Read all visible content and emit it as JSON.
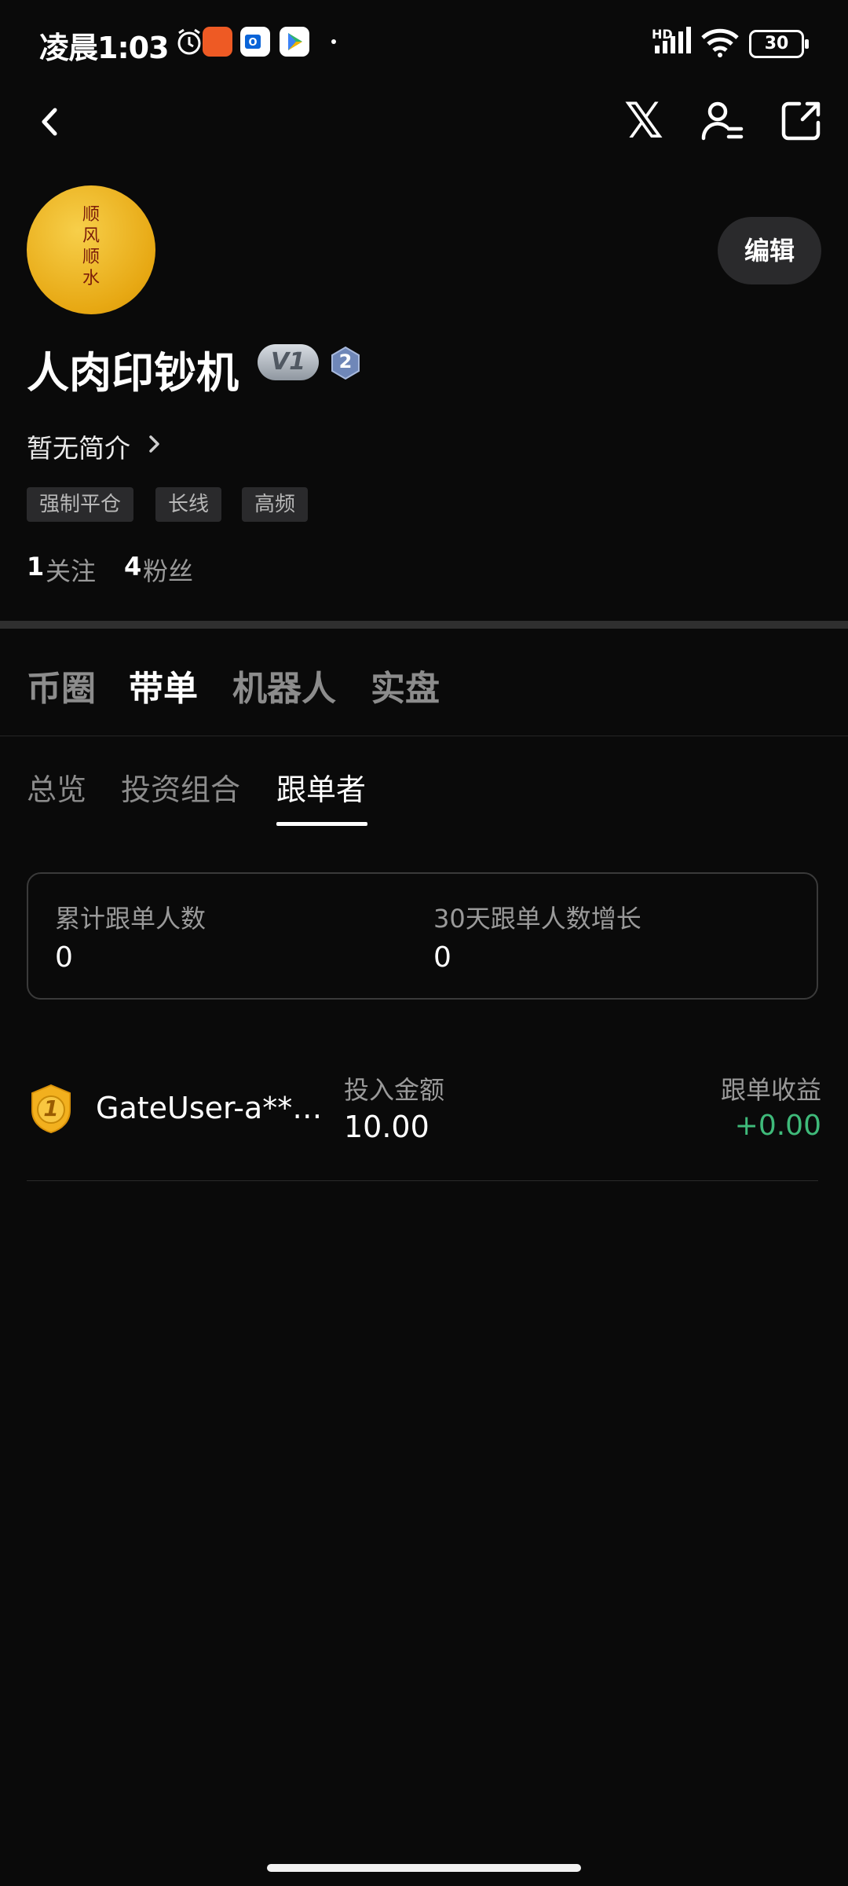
{
  "status_bar": {
    "time": "凌晨1:03",
    "battery": "30",
    "network": "HD"
  },
  "nav": {
    "x_label": "𝕏"
  },
  "profile": {
    "avatar_text": [
      "顺",
      "风",
      "顺",
      "水"
    ],
    "edit_label": "编辑",
    "username": "人肉印钞机",
    "vip_badge": "V1",
    "level_badge": "2",
    "bio": "暂无简介",
    "tags": [
      "强制平仓",
      "长线",
      "高频"
    ],
    "following_count": "1",
    "following_label": "关注",
    "followers_count": "4",
    "followers_label": "粉丝"
  },
  "main_tabs": [
    {
      "label": "币圈",
      "active": false
    },
    {
      "label": "带单",
      "active": true
    },
    {
      "label": "机器人",
      "active": false
    },
    {
      "label": "实盘",
      "active": false
    }
  ],
  "sub_tabs": [
    {
      "label": "总览",
      "active": false
    },
    {
      "label": "投资组合",
      "active": false
    },
    {
      "label": "跟单者",
      "active": true
    }
  ],
  "summary": {
    "total_label": "累计跟单人数",
    "total_value": "0",
    "growth_label": "30天跟单人数增长",
    "growth_value": "0"
  },
  "followers": [
    {
      "rank": "1",
      "name": "GateUser-a**…",
      "amount_label": "投入金额",
      "amount": "10.00",
      "profit_label": "跟单收益",
      "profit": "+0.00"
    }
  ],
  "colors": {
    "background": "#0a0a0a",
    "profit_green": "#3fba7a",
    "medal_gold": "#f2b01e"
  }
}
